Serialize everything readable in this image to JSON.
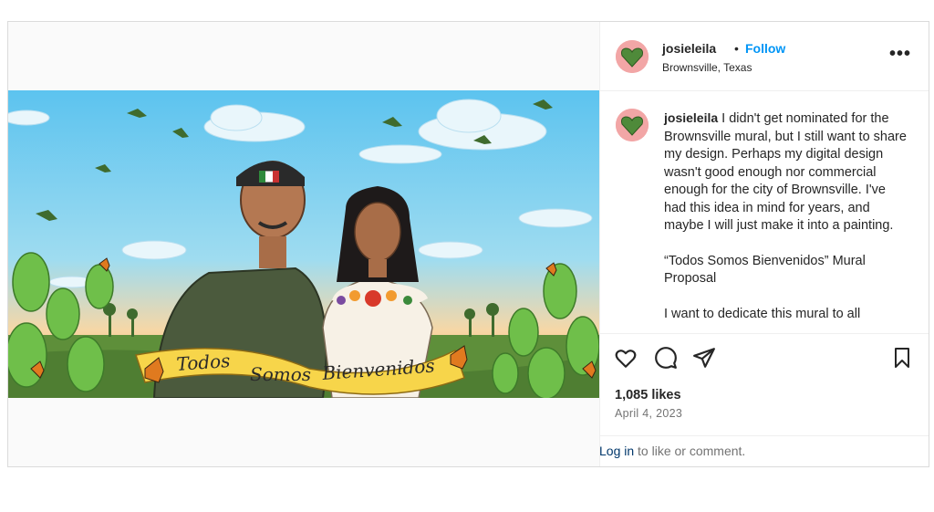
{
  "post": {
    "username": "josieleila",
    "dot": "•",
    "follow_label": "Follow",
    "location": "Brownsville, Texas",
    "more_label": "•••",
    "image_banner_text": "Todos Somos Bienvenidos",
    "caption": {
      "username": "josieleila",
      "text_1": " I didn't get nominated for the Brownsville mural, but I still want to share my design. Perhaps my digital design wasn't good enough nor commercial enough for the city of Brownsville. I've had this idea in mind for years, and maybe I will just make it into a painting.",
      "text_2": "“Todos Somos Bienvenidos” Mural Proposal",
      "text_3": "I want to dedicate this mural to all"
    },
    "likes": "1,085 likes",
    "date": "April 4, 2023",
    "login_link": "Log in",
    "login_rest": " to like or comment."
  },
  "icons": {
    "like": "heart-icon",
    "comment": "comment-icon",
    "share": "share-icon",
    "save": "bookmark-icon",
    "more": "more-options-icon"
  },
  "colors": {
    "follow": "#0095f6",
    "login": "#00376b",
    "muted": "#737373",
    "border": "#dbdbdb"
  }
}
